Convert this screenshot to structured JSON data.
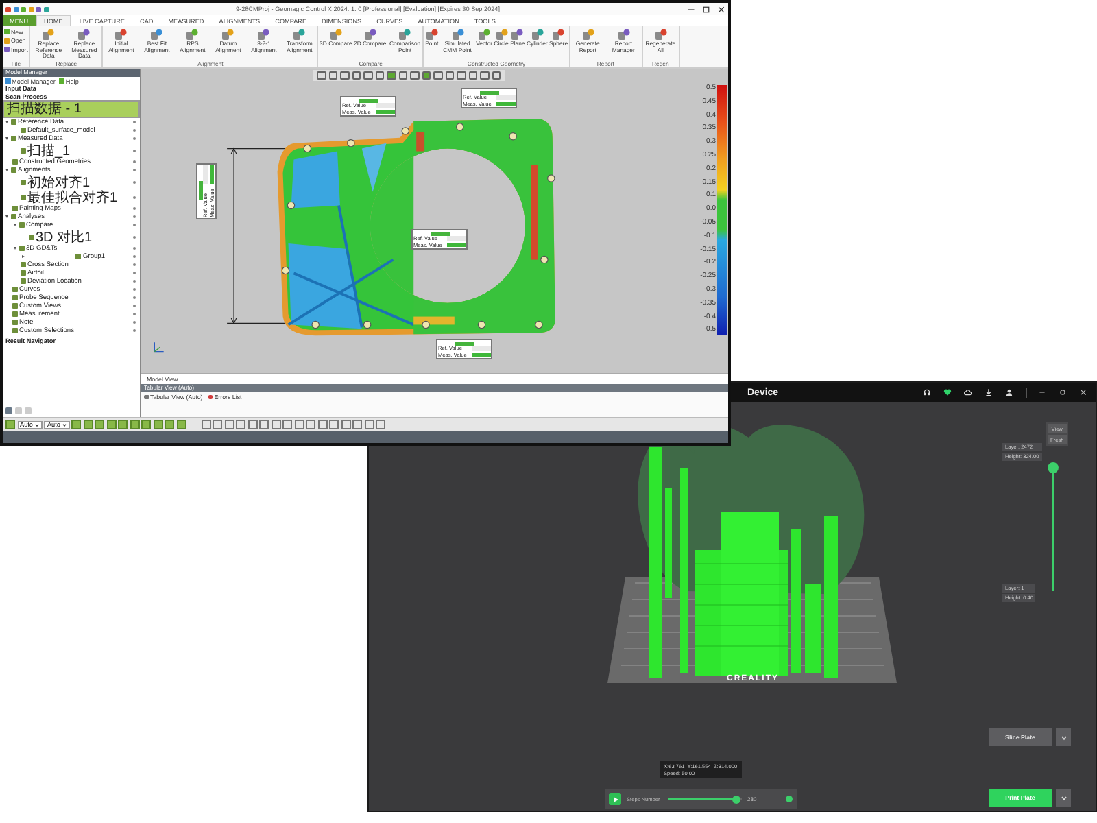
{
  "geomagic": {
    "title": "9-28CMProj - Geomagic Control X 2024. 1. 0 [Professional] [Evaluation] [Expires 30 Sep 2024]",
    "tabs": [
      {
        "label": "MENU",
        "kind": "menu",
        "selected": false
      },
      {
        "label": "HOME",
        "kind": "tab",
        "selected": true
      },
      {
        "label": "LIVE CAPTURE",
        "kind": "tab",
        "selected": false
      },
      {
        "label": "CAD",
        "kind": "tab",
        "selected": false
      },
      {
        "label": "MEASURED",
        "kind": "tab",
        "selected": false
      },
      {
        "label": "ALIGNMENTS",
        "kind": "tab",
        "selected": false
      },
      {
        "label": "COMPARE",
        "kind": "tab",
        "selected": false
      },
      {
        "label": "DIMENSIONS",
        "kind": "tab",
        "selected": false
      },
      {
        "label": "CURVES",
        "kind": "tab",
        "selected": false
      },
      {
        "label": "AUTOMATION",
        "kind": "tab",
        "selected": false
      },
      {
        "label": "TOOLS",
        "kind": "tab",
        "selected": false
      }
    ],
    "ribbon_groups": [
      {
        "label": "File",
        "kind": "list",
        "buttons": [
          "New",
          "Open",
          "Import"
        ]
      },
      {
        "label": "Replace",
        "kind": "large",
        "buttons": [
          "Replace Reference Data",
          "Replace Measured Data"
        ]
      },
      {
        "label": "Alignment",
        "kind": "large",
        "buttons": [
          "Initial Alignment",
          "Best Fit Alignment",
          "RPS Alignment",
          "Datum Alignment",
          "3-2-1 Alignment",
          "Transform Alignment"
        ]
      },
      {
        "label": "Compare",
        "kind": "large",
        "buttons": [
          "3D Compare",
          "2D Compare",
          "Comparison Point"
        ]
      },
      {
        "label": "Constructed Geometry",
        "kind": "large",
        "buttons": [
          "Point",
          "Simulated CMM Point",
          "Vector",
          "Circle",
          "Plane",
          "Cylinder",
          "Sphere"
        ]
      },
      {
        "label": "Report",
        "kind": "large",
        "buttons": [
          "Generate Report",
          "Report Manager"
        ]
      },
      {
        "label": "Regen",
        "kind": "large",
        "buttons": [
          "Regenerate All"
        ]
      }
    ],
    "panel_title": "Model Manager",
    "panel_tabs": [
      "Model Manager",
      "Help"
    ],
    "headings": [
      "Input Data",
      "Scan Process"
    ],
    "process_step": {
      "label": "扫描数据 - 1",
      "selected": true
    },
    "tree": [
      {
        "label": "Reference Data",
        "expanded": true,
        "children": [
          {
            "label": "Default_surface_model"
          }
        ]
      },
      {
        "label": "Measured Data",
        "expanded": true,
        "children": [
          {
            "label": "扫描_1"
          }
        ]
      },
      {
        "label": "Constructed Geometries"
      },
      {
        "label": "Alignments",
        "expanded": true,
        "children": [
          {
            "label": "初始对齐1"
          },
          {
            "label": "最佳拟合对齐1"
          }
        ]
      },
      {
        "label": "Painting Maps"
      },
      {
        "label": "Analyses",
        "expanded": true,
        "children": [
          {
            "label": "Compare",
            "expanded": true,
            "children": [
              {
                "label": "3D 对比1"
              }
            ]
          },
          {
            "label": "3D GD&Ts",
            "expanded": true,
            "children": [
              {
                "label": "Group1",
                "expanded": false
              }
            ]
          },
          {
            "label": "Cross Section"
          },
          {
            "label": "Airfoil"
          },
          {
            "label": "Deviation Location"
          }
        ]
      },
      {
        "label": "Curves"
      },
      {
        "label": "Probe Sequence"
      },
      {
        "label": "Custom Views"
      },
      {
        "label": "Measurement"
      },
      {
        "label": "Note"
      },
      {
        "label": "Custom Selections"
      }
    ],
    "result_navigator": "Result Navigator",
    "callouts": [
      {
        "kind": "horizontal",
        "ref_label": "Ref. Value",
        "meas_label": "Meas. Value"
      },
      {
        "kind": "horizontal",
        "ref_label": "Ref. Value",
        "meas_label": "Meas. Value"
      },
      {
        "kind": "horizontal",
        "ref_label": "Ref. Value",
        "meas_label": "Meas. Value"
      },
      {
        "kind": "horizontal",
        "ref_label": "Ref. Value",
        "meas_label": "Meas. Value"
      },
      {
        "kind": "vertical",
        "ref_label": "Ref. Value",
        "meas_label": "Meas. Value"
      }
    ],
    "legend": [
      "0.5",
      "0.45",
      "0.4",
      "0.35",
      "0.3",
      "0.25",
      "0.2",
      "0.15",
      "0.1",
      "0.0",
      "-0.05",
      "-0.1",
      "-0.15",
      "-0.2",
      "-0.25",
      "-0.3",
      "-0.35",
      "-0.4",
      "-0.5"
    ],
    "model_view_tab": "Model View",
    "tabular_bar": "Tabular View (Auto)",
    "bottom_tabs": [
      "Tabular View (Auto)",
      "Errors List"
    ],
    "selectors": [
      "Auto",
      "Auto"
    ]
  },
  "device": {
    "title": "Device",
    "view_buttons": [
      "View",
      "Fresh"
    ],
    "top_layer": {
      "layer": "Layer: 2472",
      "height": "Height: 324.00"
    },
    "bottom_layer": {
      "layer": "Layer: 1",
      "height": "Height: 0.40"
    },
    "layer_slider": {
      "level": 1.0
    },
    "bed_logo": "CREALITY",
    "tooltip": {
      "coords": "X:63.761  Y:161.554  Z:314.000",
      "speed": "Speed: 50.00"
    },
    "steps": {
      "label": "Steps Number",
      "level": 0.93,
      "value": "280"
    },
    "slice_button": "Slice Plate",
    "print_button": "Print Plate"
  }
}
